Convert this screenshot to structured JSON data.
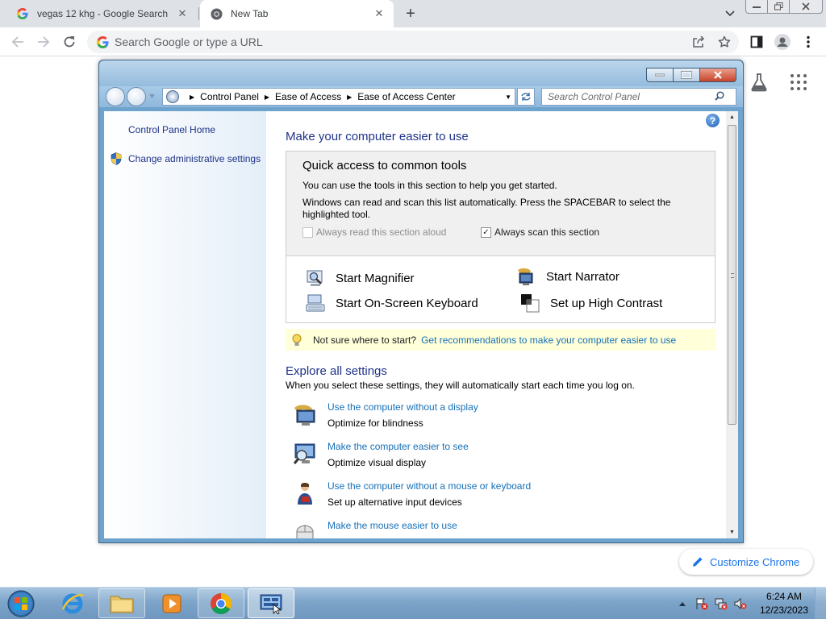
{
  "browser": {
    "tabs": [
      {
        "title": "vegas 12 khg - Google Search",
        "close": "✕"
      },
      {
        "title": "New Tab",
        "close": "✕"
      }
    ],
    "new_tab_label": "+",
    "omnibox": {
      "placeholder": "Search Google or type a URL"
    },
    "customize_label": "Customize Chrome"
  },
  "control_panel": {
    "breadcrumb": [
      "Control Panel",
      "Ease of Access",
      "Ease of Access Center"
    ],
    "search_placeholder": "Search Control Panel",
    "sidebar": {
      "home": "Control Panel Home",
      "admin": "Change administrative settings"
    },
    "help_label": "?",
    "main_title": "Make your computer easier to use",
    "quick_access": {
      "title": "Quick access to common tools",
      "text1": "You can use the tools in this section to help you get started.",
      "text2": "Windows can read and scan this list automatically.  Press the SPACEBAR to select the highlighted tool.",
      "read_aloud": {
        "label": "Always read this section aloud",
        "checked": false,
        "disabled": true
      },
      "scan": {
        "label": "Always scan this section",
        "checked": true,
        "mark": "✓"
      },
      "tools": {
        "magnifier": "Start Magnifier",
        "narrator": "Start Narrator",
        "keyboard": "Start On-Screen Keyboard",
        "contrast": "Set up High Contrast"
      }
    },
    "tip": {
      "text": "Not sure where to start?",
      "link": "Get recommendations to make your computer easier to use"
    },
    "explore": {
      "title": "Explore all settings",
      "subtitle": "When you select these settings, they will automatically start each time you log on.",
      "items": [
        {
          "link": "Use the computer without a display",
          "desc": "Optimize for blindness"
        },
        {
          "link": "Make the computer easier to see",
          "desc": "Optimize visual display"
        },
        {
          "link": "Use the computer without a mouse or keyboard",
          "desc": "Set up alternative input devices"
        },
        {
          "link": "Make the mouse easier to use",
          "desc": ""
        }
      ]
    }
  },
  "taskbar": {
    "time": "6:24 AM",
    "date": "12/23/2023"
  },
  "colors": {
    "link": "#1670b8",
    "heading": "#1e3287",
    "chrome_accent": "#1a73e8",
    "tip_background": "#ffffd9"
  }
}
